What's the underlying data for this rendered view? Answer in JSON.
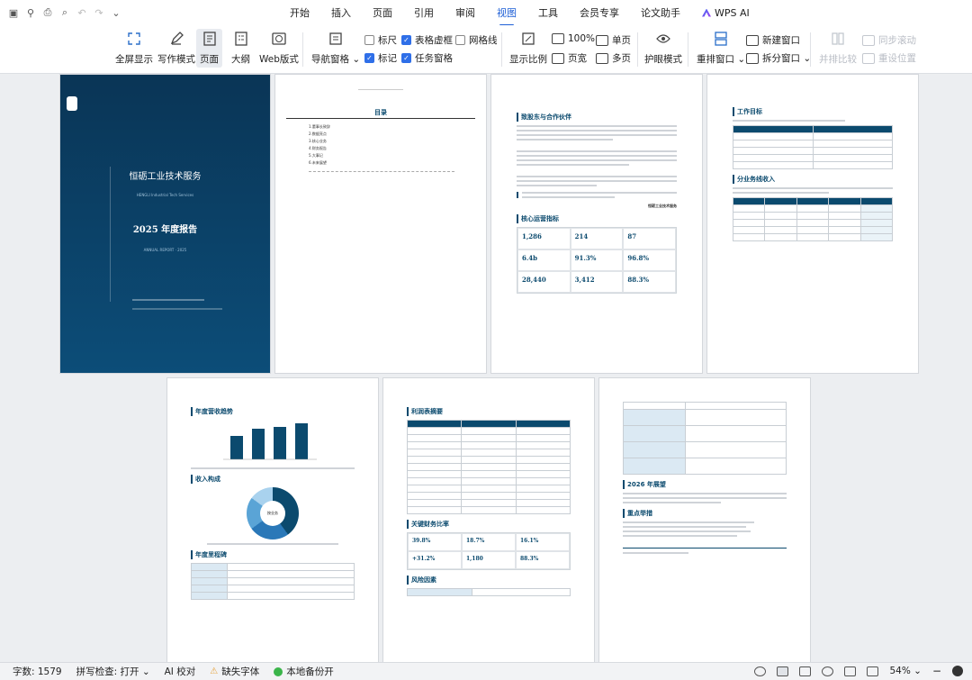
{
  "quick_access": [
    "save-icon",
    "tools-icon",
    "print-icon",
    "preview-icon",
    "undo-icon",
    "redo-icon",
    "chevron-down-icon"
  ],
  "menu": [
    "开始",
    "插入",
    "页面",
    "引用",
    "审阅",
    "视图",
    "工具",
    "会员专享",
    "论文助手",
    "WPS AI"
  ],
  "active_menu": "视图",
  "ribbon": {
    "fullscreen": "全屏显示",
    "writing": "写作模式",
    "page": "页面",
    "outline": "大纲",
    "web": "Web版式",
    "nav_pane": "导航窗格",
    "ruler": "标尺",
    "table_grid": "表格虚框",
    "gridlines": "网格线",
    "marks": "标记",
    "task_pane": "任务窗格",
    "show_ratio": "显示比例",
    "zoom100": "100%",
    "fit_page": "页宽",
    "single_page": "单页",
    "multi_page": "多页",
    "eye_mode": "护眼模式",
    "rearrange": "重排窗口",
    "new_window": "新建窗口",
    "split_window": "拆分窗口",
    "side_compare": "并排比较",
    "sync_scroll": "同步滚动",
    "reset_pos": "重设位置"
  },
  "checkboxes": {
    "ruler": false,
    "table_grid": true,
    "gridlines": false,
    "marks": true,
    "task_pane": true
  },
  "pages": {
    "cover": {
      "company": "恒砺工业技术服务",
      "subtitle": "HENGLI Industrial Tech Services",
      "title": "2025 年度报告",
      "eng": "ANNUAL REPORT · 2025"
    },
    "toc": {
      "title": "目录",
      "items": [
        "1.董事长致辞",
        "2.数据亮点",
        "3.核心业务",
        "4.财务报告",
        "5.大事记",
        "6.未来展望"
      ]
    },
    "p3": {
      "heading1": "致股东与合作伙伴",
      "heading2": "核心运营指标",
      "sign": "恒砺工业技术服务"
    },
    "p3_kpis": [
      {
        "v": "1,286"
      },
      {
        "v": "214"
      },
      {
        "v": "87"
      },
      {
        "v": "6.4b"
      },
      {
        "v": "91.3%"
      },
      {
        "v": "96.8%"
      },
      {
        "v": "28,440"
      },
      {
        "v": "3,412"
      },
      {
        "v": "88.3%"
      }
    ],
    "p4": {
      "heading1": "工作目标",
      "heading2": "分业务线收入"
    },
    "p5": {
      "heading1": "年度营收趋势",
      "heading2": "收入构成",
      "heading3": "年度里程碑",
      "donut_label": "按业务"
    },
    "p6": {
      "heading1": "利润表摘要",
      "heading2": "关键财务比率",
      "heading3": "风险因素"
    },
    "p6_kpis": [
      {
        "v": "39.8%"
      },
      {
        "v": "18.7%"
      },
      {
        "v": "16.1%"
      },
      {
        "v": "+31.2%"
      },
      {
        "v": "1,180"
      },
      {
        "v": "88.3%"
      }
    ],
    "p7": {
      "heading1": "2026 年展望",
      "heading2": "重点举措"
    }
  },
  "status": {
    "words": "字数: 1579",
    "spell": "拼写检查: 打开",
    "ai": "AI 校对",
    "missing_font": "缺失字体",
    "backup": "本地备份开",
    "zoom": "54%"
  },
  "colors": {
    "accent": "#1e5fd6",
    "report_blue": "#0b4a6e",
    "cover_bg": "#0a3d62"
  }
}
